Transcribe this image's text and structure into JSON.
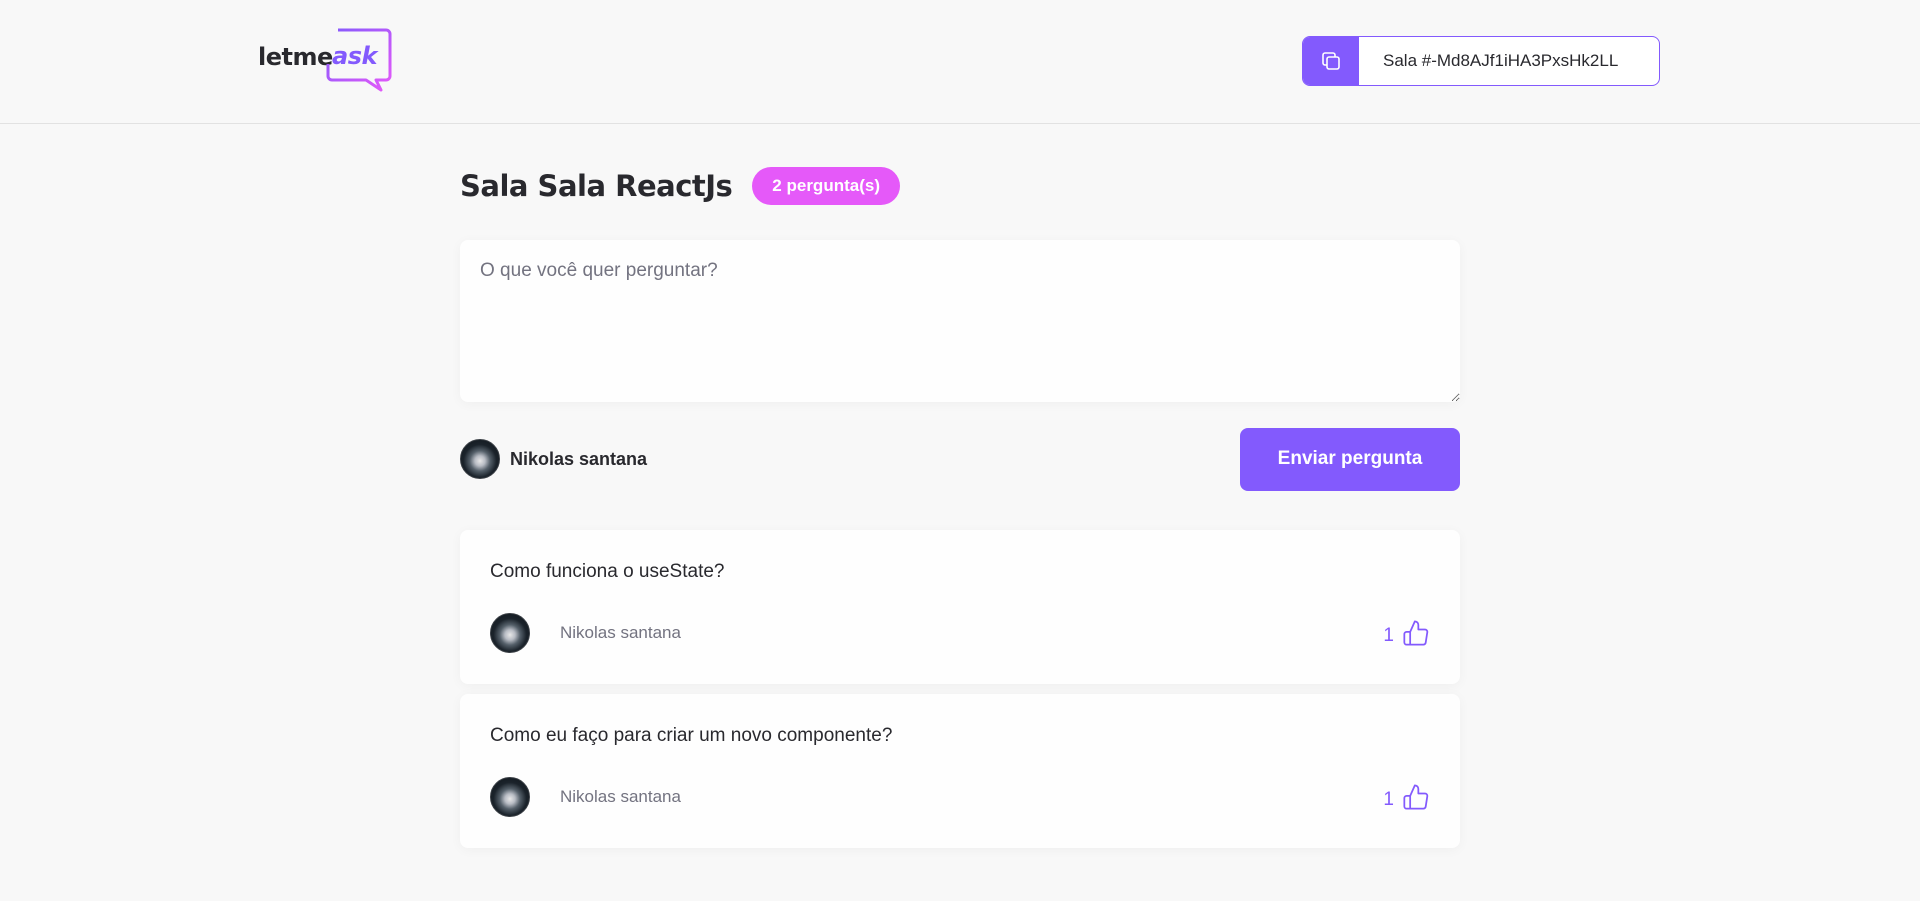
{
  "header": {
    "logo": {
      "letme": "letme",
      "ask": "ask"
    },
    "room_code": {
      "icon": "copy-icon",
      "label": "Sala #-Md8AJf1iHA3PxsHk2LL"
    }
  },
  "room": {
    "title": "Sala Sala ReactJs",
    "question_count_badge": "2 pergunta(s)"
  },
  "form": {
    "placeholder": "O que você quer perguntar?",
    "value": "",
    "user_name": "Nikolas santana",
    "submit_label": "Enviar pergunta"
  },
  "questions": [
    {
      "content": "Como funciona o useState?",
      "author": "Nikolas santana",
      "likes": "1"
    },
    {
      "content": "Como eu faço para criar um novo componente?",
      "author": "Nikolas santana",
      "likes": "1"
    }
  ],
  "colors": {
    "accent": "#835afd",
    "badge": "#e559f9",
    "background": "#f8f8f8",
    "text": "#29292e",
    "muted": "#737380"
  },
  "icons": {
    "like": "thumbs-up-icon",
    "copy": "copy-icon"
  }
}
